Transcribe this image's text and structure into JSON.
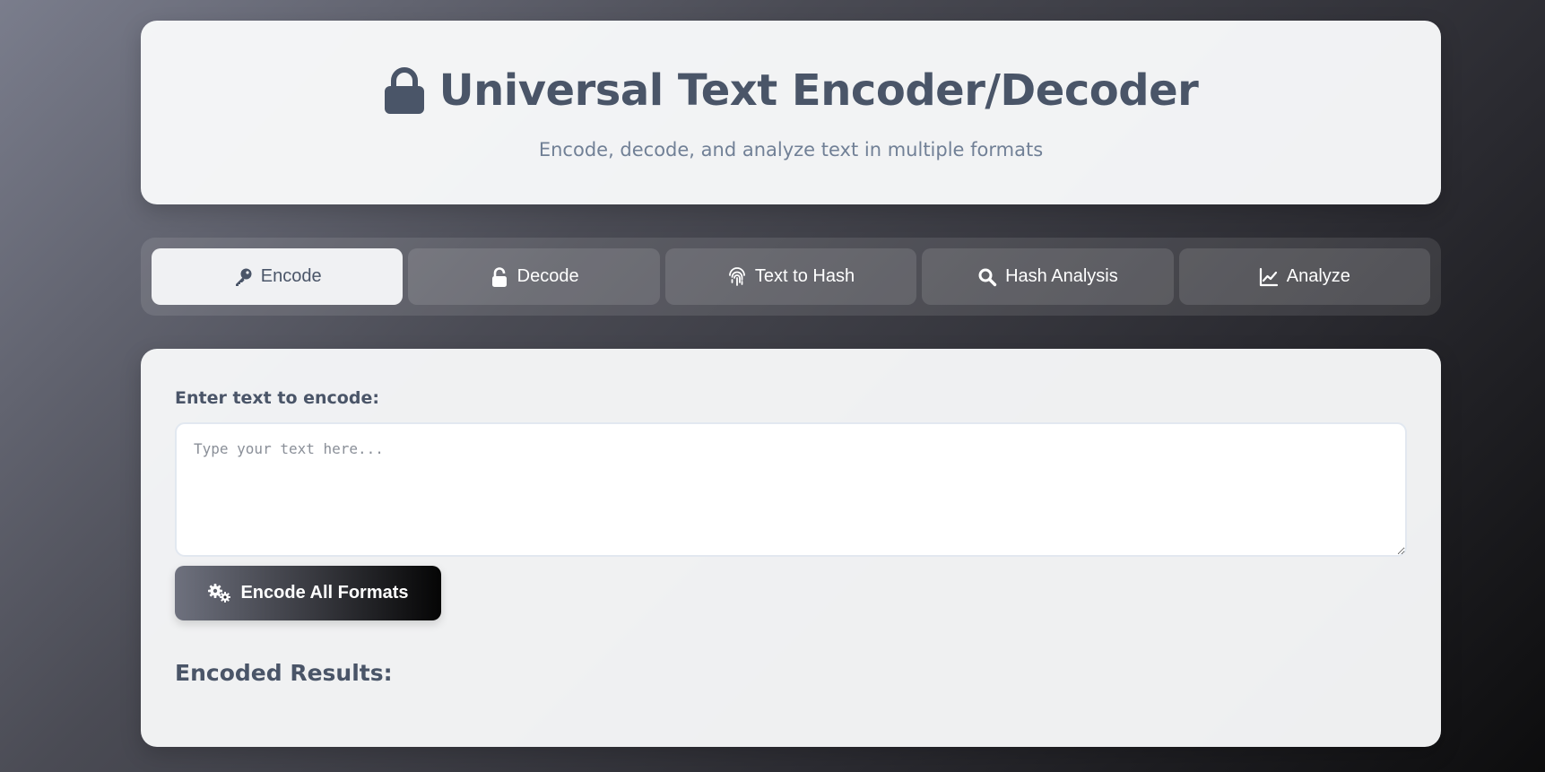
{
  "header": {
    "title": "Universal Text Encoder/Decoder",
    "subtitle": "Encode, decode, and analyze text in multiple formats",
    "icon": "lock-icon"
  },
  "tabs": [
    {
      "label": "Encode",
      "icon": "key-icon",
      "active": true
    },
    {
      "label": "Decode",
      "icon": "unlock-icon",
      "active": false
    },
    {
      "label": "Text to Hash",
      "icon": "fingerprint-icon",
      "active": false
    },
    {
      "label": "Hash Analysis",
      "icon": "search-icon",
      "active": false
    },
    {
      "label": "Analyze",
      "icon": "chart-line-icon",
      "active": false
    }
  ],
  "encode": {
    "input_label": "Enter text to encode:",
    "input_placeholder": "Type your text here...",
    "input_value": "",
    "button_label": "Encode All Formats",
    "button_icon": "cogs-icon",
    "results_heading": "Encoded Results:"
  },
  "colors": {
    "heading": "#4a5568",
    "subtitle": "#718096",
    "active_tab_bg": "#f0f1f3"
  }
}
